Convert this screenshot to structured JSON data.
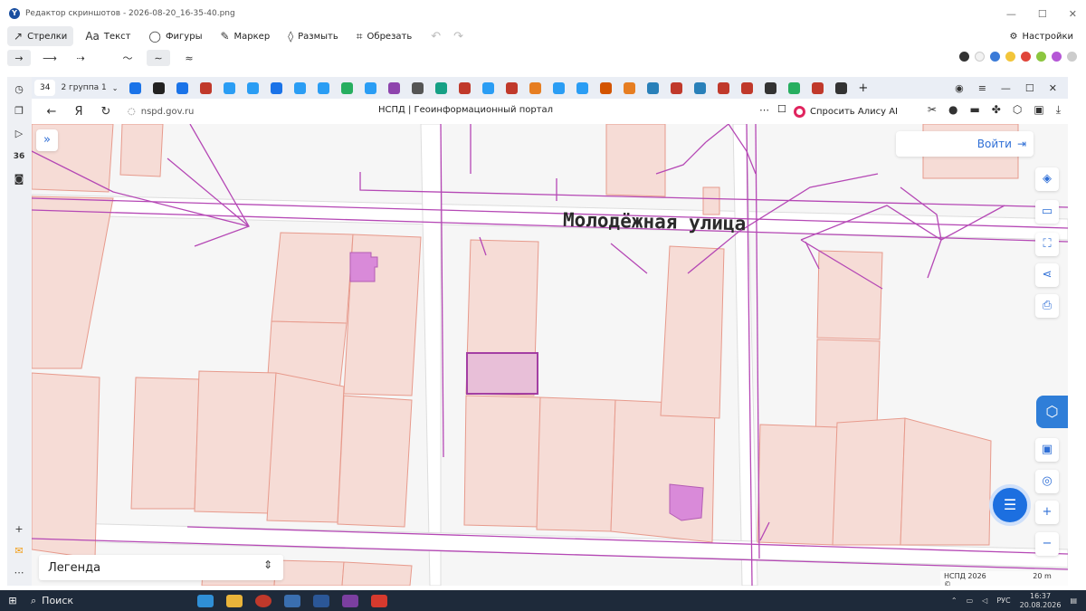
{
  "editor": {
    "title": "Редактор скриншотов - 2026-08-20_16-35-40.png",
    "tools": [
      {
        "label": "Стрелки",
        "icon": "arrow-tool-icon"
      },
      {
        "label": "Текст",
        "icon": "text-tool-icon"
      },
      {
        "label": "Фигуры",
        "icon": "shapes-tool-icon"
      },
      {
        "label": "Маркер",
        "icon": "marker-tool-icon"
      },
      {
        "label": "Размыть",
        "icon": "blur-tool-icon"
      },
      {
        "label": "Обрезать",
        "icon": "crop-tool-icon"
      }
    ],
    "active_tool": "Стрелки",
    "settings_label": "Настройки",
    "colors": [
      "#333333",
      "#f2f2f2",
      "#3b7bd8",
      "#f2c53a",
      "#e0453a",
      "#8cc63f",
      "#b557d6",
      "#cccccc"
    ]
  },
  "browser": {
    "tab_count": "34",
    "group_label": "2  группа 1",
    "url": "nspd.gov.ru",
    "page_title": "НСПД | Геоинформационный портал",
    "alice_label": "Спросить Алису AI"
  },
  "map": {
    "street_label": "Молодёжная улица",
    "login_label": "Войти",
    "legend_label": "Легенда",
    "footer_label": "НСПД 2026 ©",
    "scale_label": "20 m"
  },
  "taskbar": {
    "search_label": "Поиск",
    "lang": "РУС",
    "time": "16:37",
    "date": "20.08.2026"
  }
}
